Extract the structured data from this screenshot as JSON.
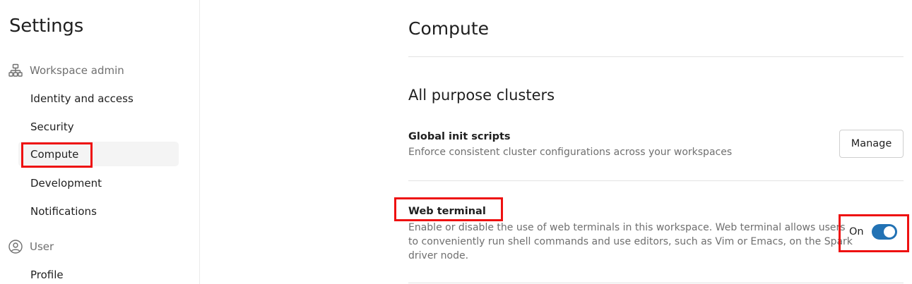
{
  "sidebar": {
    "title": "Settings",
    "workspace_group": {
      "label": "Workspace admin",
      "icon": "org-hierarchy-icon"
    },
    "items": [
      {
        "label": "Identity and access"
      },
      {
        "label": "Security"
      },
      {
        "label": "Compute",
        "active": true
      },
      {
        "label": "Development"
      },
      {
        "label": "Notifications"
      }
    ],
    "user_group": {
      "label": "User",
      "icon": "user-circle-icon"
    },
    "user_items": [
      {
        "label": "Profile"
      }
    ]
  },
  "main": {
    "title": "Compute",
    "section_title": "All purpose clusters",
    "settings": [
      {
        "title": "Global init scripts",
        "description": "Enforce consistent cluster configurations across your workspaces",
        "action_label": "Manage"
      },
      {
        "title": "Web terminal",
        "description_lines": [
          "Enable or disable the use of web terminals in this workspace. Web terminal allows users",
          "to conveniently run shell commands and use editors, such as Vim or Emacs, on the Spark",
          "driver node."
        ],
        "toggle_label": "On",
        "toggle_on": true
      }
    ]
  },
  "colors": {
    "accent": "#2272b4",
    "annotation_red": "#ee1111",
    "muted_text": "#6f6f6f"
  }
}
